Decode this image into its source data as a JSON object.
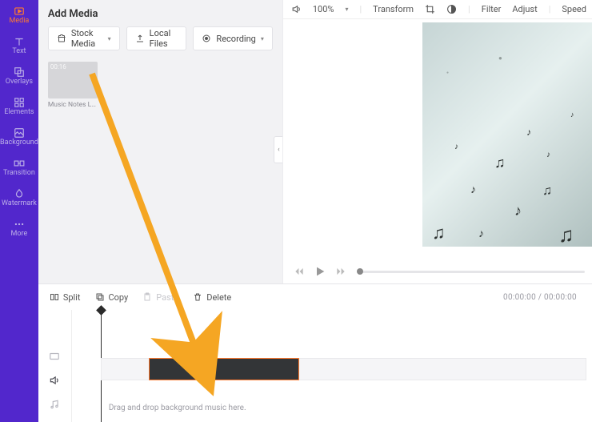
{
  "sidebar": {
    "items": [
      {
        "label": "Media"
      },
      {
        "label": "Text"
      },
      {
        "label": "Overlays"
      },
      {
        "label": "Elements"
      },
      {
        "label": "Background"
      },
      {
        "label": "Transition"
      },
      {
        "label": "Watermark"
      },
      {
        "label": "More"
      }
    ]
  },
  "mediaPanel": {
    "title": "Add Media",
    "buttons": {
      "stock": "Stock Media",
      "local": "Local Files",
      "recording": "Recording"
    },
    "clip": {
      "duration": "00:16",
      "name": "Music Notes Loop Back..."
    }
  },
  "previewToolbar": {
    "zoom": "100%",
    "transform": "Transform",
    "filter": "Filter",
    "adjust": "Adjust",
    "speed": "Speed"
  },
  "timeline": {
    "split": "Split",
    "copy": "Copy",
    "paste": "Paste",
    "delete": "Delete",
    "time": "00:00:00 / 00:00:00",
    "hint": "Drag and drop background music here."
  }
}
